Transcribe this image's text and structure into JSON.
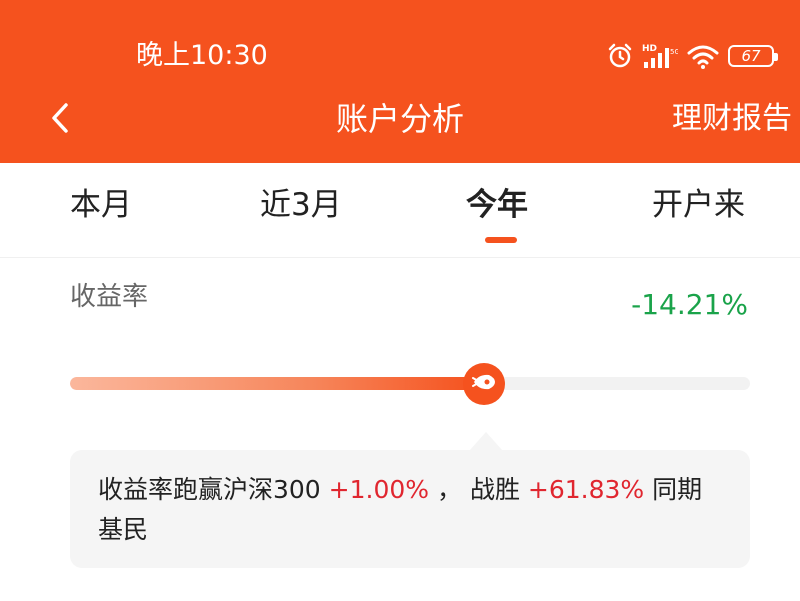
{
  "status_bar": {
    "time": "晚上10:30",
    "battery": "67",
    "icons": [
      "alarm-icon",
      "hd-signal-icon",
      "wifi-icon",
      "battery-icon"
    ]
  },
  "nav": {
    "back_icon": "chevron-left-icon",
    "title": "账户分析",
    "right_action": "理财报告"
  },
  "tabs": [
    {
      "label": "本月",
      "active": false
    },
    {
      "label": "近3月",
      "active": false
    },
    {
      "label": "今年",
      "active": true
    },
    {
      "label": "开户来",
      "active": false
    }
  ],
  "yield": {
    "label": "收益率",
    "value": "-14.21%",
    "progress_fraction": 0.6
  },
  "tip": {
    "prefix": "收益率跑赢沪深300 ",
    "beat_index": "+1.00%",
    "mid": " ，  战胜 ",
    "beat_peers": "+61.83%",
    "suffix": " 同期基民"
  },
  "colors": {
    "brand": "#f5521e",
    "negative": "#1aa34a",
    "positive": "#e0262f"
  }
}
